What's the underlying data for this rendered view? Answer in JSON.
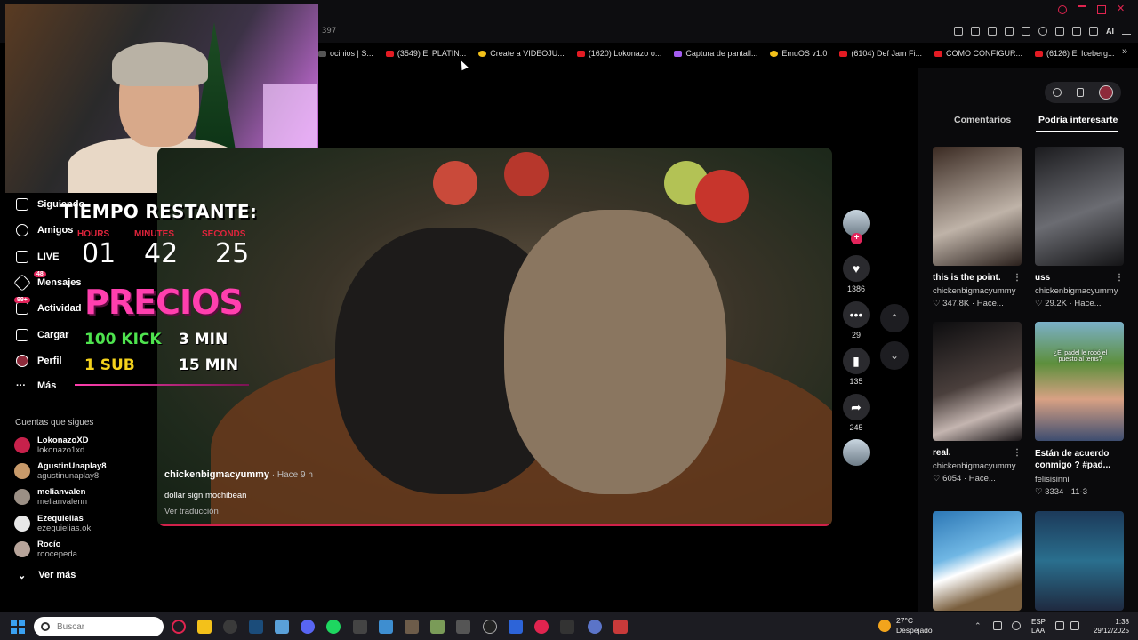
{
  "browser": {
    "url_fragment": "397",
    "bookmarks": [
      {
        "label": "ocinios | S...",
        "icon": "bookmark-icon",
        "color": "g"
      },
      {
        "label": "(3549) El PLATIN...",
        "icon": "youtube-icon",
        "color": ""
      },
      {
        "label": "Create a VIDEOJU...",
        "icon": "page-icon",
        "color": "y"
      },
      {
        "label": "(1620) Lokonazo o...",
        "icon": "youtube-icon",
        "color": ""
      },
      {
        "label": "Captura de pantall...",
        "icon": "pen-icon",
        "color": "p"
      },
      {
        "label": "EmuOS v1.0",
        "icon": "emuos-icon",
        "color": "y"
      },
      {
        "label": "(6104) Def Jam Fi...",
        "icon": "youtube-icon",
        "color": ""
      },
      {
        "label": "COMO CONFIGUR...",
        "icon": "youtube-icon",
        "color": ""
      },
      {
        "label": "(6126) El Iceberg...",
        "icon": "youtube-icon",
        "color": ""
      }
    ],
    "ai_label": "AI"
  },
  "sidebar": {
    "items": [
      {
        "label": "Siguiendo",
        "icon": "following-icon"
      },
      {
        "label": "Amigos",
        "icon": "friends-icon"
      },
      {
        "label": "LIVE",
        "icon": "live-icon"
      },
      {
        "label": "Mensajes",
        "icon": "messages-icon",
        "badge": "48"
      },
      {
        "label": "Actividad",
        "icon": "activity-icon",
        "badge": "99+"
      },
      {
        "label": "Cargar",
        "icon": "upload-icon"
      },
      {
        "label": "Perfil",
        "icon": "profile-icon"
      },
      {
        "label": "Más",
        "icon": "more-icon"
      }
    ],
    "following_title": "Cuentas que sigues",
    "accounts": [
      {
        "name": "LokonazoXD",
        "user": "lokonazo1xd"
      },
      {
        "name": "AgustinUnaplay8",
        "user": "agustinunaplay8"
      },
      {
        "name": "melianvalen",
        "user": "melianvalenn"
      },
      {
        "name": "Ezequielias",
        "user": "ezequielias.ok"
      },
      {
        "name": "Rocío",
        "user": "roocepeda"
      }
    ],
    "see_more": "Ver más"
  },
  "overlay": {
    "title": "TIEMPO RESTANTE:",
    "labels": [
      "HOURS",
      "MINUTES",
      "SECONDS"
    ],
    "hours": "01",
    "minutes": "42",
    "seconds": "25",
    "precios": "PRECIOS",
    "price1_a": "100 KICK",
    "price1_b": "3 MIN",
    "price2_a": "1 SUB",
    "price2_b": "15 MIN"
  },
  "video": {
    "author": "chickenbigmacyummy",
    "time": " · Hace 9 h",
    "caption": "dollar sign mochibean",
    "translate": "Ver traducción",
    "progress": 1.0,
    "likes": "1386",
    "comments": "29",
    "saves": "135",
    "shares": "245"
  },
  "right_panel": {
    "tabs": [
      "Comentarios",
      "Podría interesarte"
    ],
    "cards": [
      {
        "title": "this is the point.",
        "author": "chickenbigmacyummy",
        "meta": "♡ 347.8K · Hace..."
      },
      {
        "title": "uss",
        "author": "chickenbigmacyummy",
        "meta": "♡ 29.2K · Hace..."
      },
      {
        "title": "real.",
        "author": "chickenbigmacyummy",
        "meta": "♡ 6054 · Hace..."
      },
      {
        "title": "Están de acuerdo conmigo ? #pad...",
        "author": "felisisinni",
        "meta": "♡ 3334 · 11-3"
      }
    ],
    "thumb_caption": "¿El padel le robó el puesto al tenis?"
  },
  "taskbar": {
    "search_placeholder": "Buscar",
    "temperature": "27°C",
    "weather": "Despejado",
    "lang": "ESP",
    "layout": "LAA",
    "time": "1:38",
    "date": "29/12/2025"
  },
  "colors": {
    "accent": "#d0214a",
    "pink": "#ff3fae",
    "green": "#4ee34e",
    "yellow": "#f4d21c"
  }
}
